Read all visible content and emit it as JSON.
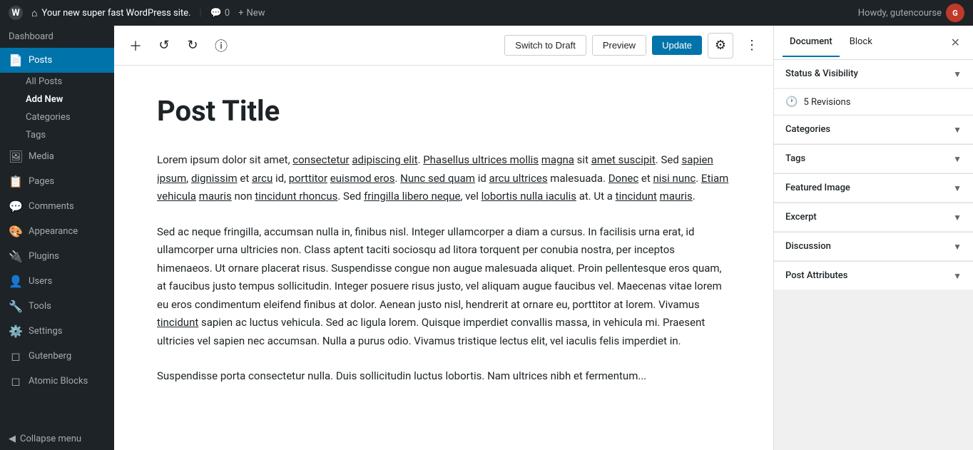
{
  "admin_bar": {
    "wp_logo": "W",
    "site_name": "Your new super fast WordPress site.",
    "comments_count": "0",
    "new_label": "New",
    "howdy": "Howdy, gutencourse",
    "avatar_text": "G"
  },
  "sidebar": {
    "dashboard_label": "Dashboard",
    "items": [
      {
        "id": "posts",
        "label": "Posts",
        "icon": "📄",
        "active": true
      },
      {
        "id": "all-posts",
        "label": "All Posts",
        "sub": true
      },
      {
        "id": "add-new",
        "label": "Add New",
        "sub": true,
        "active_sub": true
      },
      {
        "id": "categories",
        "label": "Categories",
        "sub": true
      },
      {
        "id": "tags",
        "label": "Tags",
        "sub": true
      },
      {
        "id": "media",
        "label": "Media",
        "icon": "🖼️"
      },
      {
        "id": "pages",
        "label": "Pages",
        "icon": "📋"
      },
      {
        "id": "comments",
        "label": "Comments",
        "icon": "💬"
      },
      {
        "id": "appearance",
        "label": "Appearance",
        "icon": "🎨"
      },
      {
        "id": "plugins",
        "label": "Plugins",
        "icon": "🔌"
      },
      {
        "id": "users",
        "label": "Users",
        "icon": "👤"
      },
      {
        "id": "tools",
        "label": "Tools",
        "icon": "🔧"
      },
      {
        "id": "settings",
        "label": "Settings",
        "icon": "⚙️"
      },
      {
        "id": "gutenberg",
        "label": "Gutenberg",
        "icon": "◻"
      },
      {
        "id": "atomic-blocks",
        "label": "Atomic Blocks",
        "icon": "◻"
      }
    ],
    "collapse_label": "Collapse menu"
  },
  "toolbar": {
    "switch_to_draft_label": "Switch to Draft",
    "preview_label": "Preview",
    "update_label": "Update"
  },
  "editor": {
    "post_title": "Post Title",
    "paragraphs": [
      "Lorem ipsum dolor sit amet, consectetur adipiscing elit. Phasellus ultrices mollis magna sit amet suscipit. Sed sapien ipsum, dignissim et arcu id, porttitor euismod eros. Nunc sed quam id arcu ultrices malesuada. Donec et nisi nunc. Etiam vehicula mauris non tincidunt rhoncus. Sed fringilla libero neque, vel lobortis nulla iaculis at. Ut a tincidunt mauris.",
      "Sed ac neque fringilla, accumsan nulla in, finibus nisl. Integer ullamcorper a diam a cursus. In facilisis urna erat, id ullamcorper urna ultricies non. Class aptent taciti sociosqu ad litora torquent per conubia nostra, per inceptos himenaeos. Ut ornare placerat risus. Suspendisse congue non augue malesuada aliquet. Proin pellentesque eros quam, at faucibus justo tempus sollicitudin. Integer posuere risus justo, vel aliquam augue faucibus vel. Maecenas vitae lorem eu eros condimentum eleifend finibus at dolor. Aenean justo nisl, hendrerit at ornare eu, porttitor at lorem. Vivamus tincidunt sapien ac luctus vehicula. Sed ac ligula lorem. Quisque imperdiet convallis massa, in vehicula mi. Praesent ultricies vel sapien nec accumsan. Nulla a purus odio. Vivamus tristique lectus elit, vel iaculis felis imperdiet in.",
      "Suspendisse porta consectetur nulla. Duis sollicitudin luctus lobortis. Nam ultrices nibh et fermentum..."
    ]
  },
  "right_panel": {
    "tabs": [
      {
        "id": "document",
        "label": "Document",
        "active": true
      },
      {
        "id": "block",
        "label": "Block"
      }
    ],
    "sections": [
      {
        "id": "status-visibility",
        "label": "Status & Visibility",
        "expanded": true
      },
      {
        "id": "revisions",
        "label": "5 Revisions",
        "is_revisions": true
      },
      {
        "id": "categories",
        "label": "Categories"
      },
      {
        "id": "tags",
        "label": "Tags"
      },
      {
        "id": "featured-image",
        "label": "Featured Image"
      },
      {
        "id": "excerpt",
        "label": "Excerpt"
      },
      {
        "id": "discussion",
        "label": "Discussion"
      },
      {
        "id": "post-attributes",
        "label": "Post Attributes"
      }
    ]
  }
}
